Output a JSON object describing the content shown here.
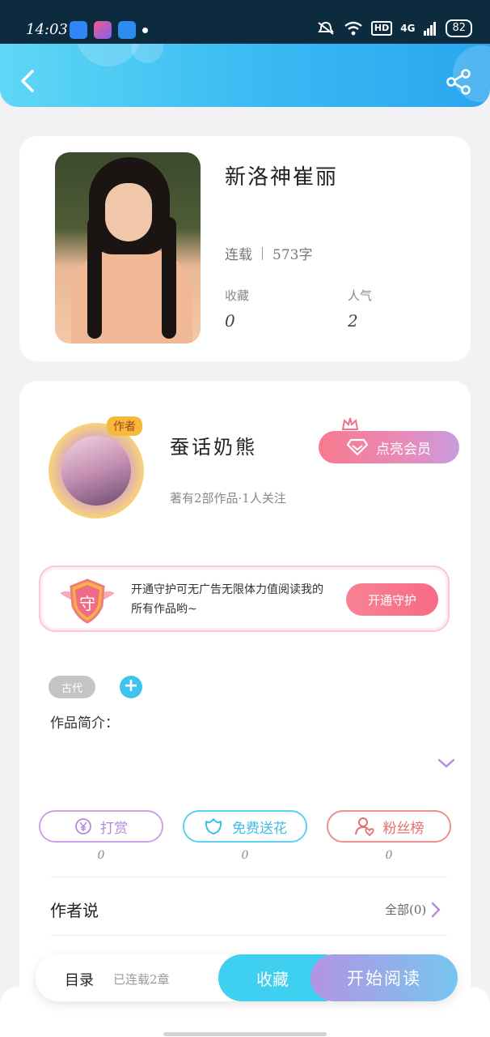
{
  "status_bar": {
    "time": "14:03",
    "network": "4G",
    "hd": "HD",
    "battery": "82"
  },
  "header": {
    "back_icon": "chevron-left-icon",
    "share_icon": "share-icon",
    "gradient_start": "#5fd7f5",
    "gradient_end": "#2aa6f0"
  },
  "book": {
    "title": "新洛神崔丽",
    "status": "连载",
    "word_count": "573字",
    "favorites_label": "收藏",
    "favorites_value": "0",
    "popularity_label": "人气",
    "popularity_value": "2"
  },
  "author": {
    "badge": "作者",
    "name": "蚕话奶熊",
    "meta": "著有2部作品·1人关注",
    "vip_label": "点亮会员"
  },
  "guard": {
    "badge_char": "守",
    "text": "开通守护可无广告无限体力值阅读我的所有作品哟~",
    "button": "开通守护"
  },
  "tags": {
    "items": [
      "古代"
    ],
    "add_symbol": "+"
  },
  "intro": {
    "label": "作品简介："
  },
  "actions": [
    {
      "label": "打赏",
      "icon": "yen-coin-icon",
      "count": "0",
      "color": "#b38ad8"
    },
    {
      "label": "免费送花",
      "icon": "flower-icon",
      "count": "0",
      "color": "#3dbfe6"
    },
    {
      "label": "粉丝榜",
      "icon": "user-heart-icon",
      "count": "0",
      "color": "#e76e6e"
    }
  ],
  "author_says": {
    "title": "作者说",
    "link": "全部(0)"
  },
  "bottom_bar": {
    "toc": "目录",
    "toc_sub": "已连载2章",
    "favorite": "收藏",
    "read": "开始阅读"
  }
}
